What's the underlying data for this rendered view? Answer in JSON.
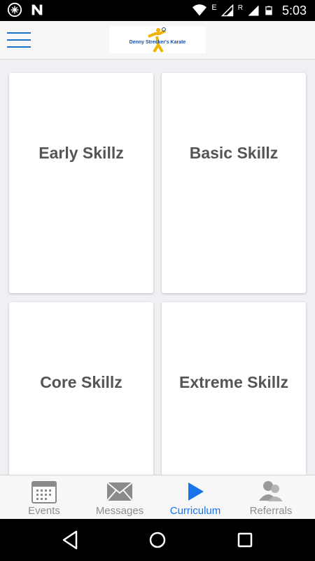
{
  "status_bar": {
    "time": "5:03",
    "icons": [
      "notification-icon",
      "n-icon",
      "wifi-icon",
      "network-e-icon",
      "signal-icon",
      "roaming-r-icon",
      "signal-icon-2",
      "battery-icon"
    ],
    "network_e": "E",
    "roaming_r": "R"
  },
  "header": {
    "logo_text": "Denny Strecker's Karate",
    "accent_color": "#1a73c8"
  },
  "cards": [
    {
      "label": "Early Skillz"
    },
    {
      "label": "Basic Skillz"
    },
    {
      "label": "Core Skillz"
    },
    {
      "label": "Extreme Skillz"
    }
  ],
  "tabbar": {
    "tabs": [
      {
        "label": "Events",
        "icon": "calendar-icon",
        "active": false
      },
      {
        "label": "Messages",
        "icon": "envelope-icon",
        "active": false
      },
      {
        "label": "Curriculum",
        "icon": "play-icon",
        "active": true
      },
      {
        "label": "Referrals",
        "icon": "people-icon",
        "active": false
      }
    ],
    "active_color": "#1a73e8",
    "inactive_color": "#8e8e8e"
  },
  "nav_bar": {
    "buttons": [
      "back-icon",
      "home-icon",
      "recents-icon"
    ]
  }
}
